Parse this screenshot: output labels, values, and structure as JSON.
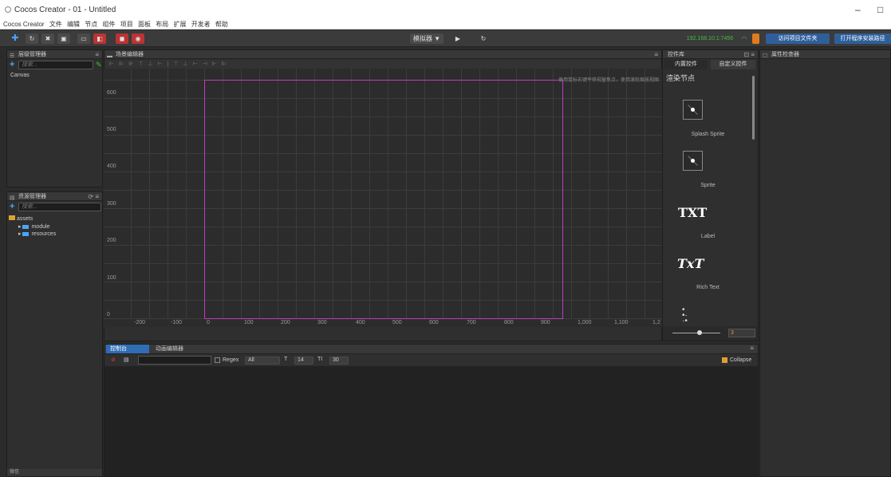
{
  "window": {
    "title": "Cocos Creator - 01 - Untitled",
    "min": "–",
    "max": "□"
  },
  "menubar": [
    "Cocos Creator",
    "文件",
    "编辑",
    "节点",
    "组件",
    "项目",
    "面板",
    "布局",
    "扩展",
    "开发者",
    "帮助"
  ],
  "toolbar": {
    "preview_select": "模拟器 ▼",
    "ip": "192.168.10.1:7456",
    "open_project": "访问项目文件夹",
    "open_install": "打开程序安装路径"
  },
  "hierarchy": {
    "title": "层级管理器",
    "search_placeholder": "搜索...",
    "items": [
      "Canvas"
    ]
  },
  "assets": {
    "title": "资源管理器",
    "search_placeholder": "搜索...",
    "root": "assets",
    "folders": [
      "module",
      "resources"
    ]
  },
  "scene": {
    "title": "场景编辑器",
    "hint": "使用鼠标右键平移视窗焦点，使用滚轮缩放视图",
    "y_ticks": [
      "600",
      "500",
      "400",
      "300",
      "200",
      "100",
      "0"
    ],
    "x_ticks": [
      "-200",
      "-100",
      "0",
      "100",
      "200",
      "300",
      "400",
      "500",
      "600",
      "700",
      "800",
      "900",
      "1,000",
      "1,100",
      "1,2"
    ]
  },
  "widgets": {
    "title": "控件库",
    "tab_builtin": "内置控件",
    "tab_custom": "自定义控件",
    "section": "渲染节点",
    "items": [
      {
        "name": "Splash Sprite"
      },
      {
        "name": "Sprite"
      },
      {
        "name": "Label",
        "glyph": "TXT"
      },
      {
        "name": "Rich Text",
        "glyph": "TxT"
      }
    ],
    "zoom": "3"
  },
  "inspector": {
    "title": "属性检查器"
  },
  "console": {
    "tab_console": "控制台",
    "tab_anim": "动画编辑器",
    "regex": "Regex",
    "level": "All",
    "font_size": "14",
    "line_height": "30",
    "collapse": "Collapse"
  },
  "footer": {
    "label": "微信"
  },
  "colors": {
    "accent": "#4aa3ff",
    "design_rect": "#c03cc0",
    "bg": "#2b2b2b"
  }
}
